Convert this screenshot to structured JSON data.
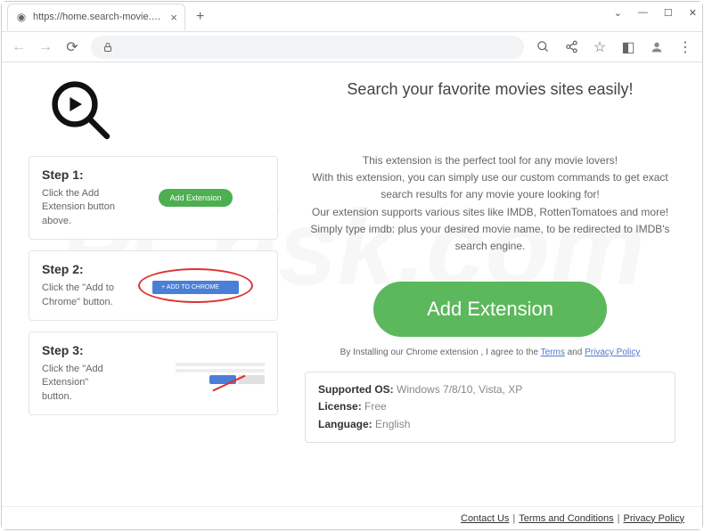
{
  "browser": {
    "url": "https://home.search-movie.com",
    "tab_title": "https://home.search-movie.com"
  },
  "page": {
    "headline": "Search your favorite movies sites easily!",
    "description": "This extension is the perfect tool for any movie lovers!\nWith this extension, you can simply use our custom commands to get exact search results for any movie youre looking for!\nOur extension supports various sites like IMDB, RottenTomatoes and more!\nSimply type imdb: plus your desired movie name, to be redirected to IMDB's search engine.",
    "main_button": "Add Extension",
    "agree_prefix": "By Installing our Chrome extension , I agree to the ",
    "agree_terms": "Terms",
    "agree_and": " and ",
    "agree_privacy": "Privacy Policy",
    "info": {
      "os_label": "Supported OS:",
      "os_value": "Windows 7/8/10, Vista, XP",
      "license_label": "License:",
      "license_value": "Free",
      "language_label": "Language:",
      "language_value": "English"
    }
  },
  "steps": [
    {
      "title": "Step 1:",
      "desc": "Click the Add Extension button above.",
      "button_label": "Add Extension"
    },
    {
      "title": "Step 2:",
      "desc": "Click the \"Add to Chrome\" button.",
      "button_label": "+ ADD TO CHROME"
    },
    {
      "title": "Step 3:",
      "desc": "Click the \"Add Extension\" button."
    }
  ],
  "footer": {
    "contact": "Contact Us",
    "terms": "Terms and Conditions",
    "privacy": "Privacy Policy"
  }
}
